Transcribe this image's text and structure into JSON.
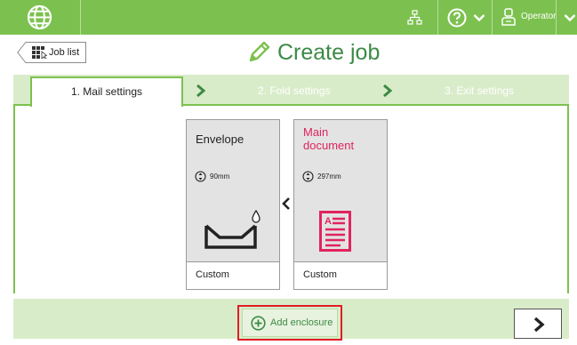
{
  "topbar": {
    "user_label": "Operator"
  },
  "header": {
    "job_list_label": "Job list",
    "title": "Create job"
  },
  "tabs": [
    {
      "label": "1. Mail settings",
      "active": true
    },
    {
      "label": "2. Fold settings",
      "active": false
    },
    {
      "label": "3. Exit settings",
      "active": false
    }
  ],
  "cards": [
    {
      "name": "Envelope",
      "dimension": "90mm",
      "footer": "Custom"
    },
    {
      "name": "Main document",
      "dimension": "297mm",
      "footer": "Custom"
    }
  ],
  "footer": {
    "add_enclosure_label": "Add enclosure"
  },
  "colors": {
    "brand_green": "#7cc14f",
    "light_green": "#d9ecc9",
    "title_green": "#3c8a46",
    "accent_red": "#e0245e",
    "highlight_red": "#e01d25"
  },
  "icons": [
    "globe-icon",
    "network-icon",
    "help-icon",
    "chevron-down-icon",
    "user-icon",
    "grid-icon",
    "pencil-icon",
    "rotate-icon",
    "envelope-icon",
    "document-icon",
    "chevron-left-icon",
    "plus-circle-icon",
    "chevron-right-icon"
  ]
}
